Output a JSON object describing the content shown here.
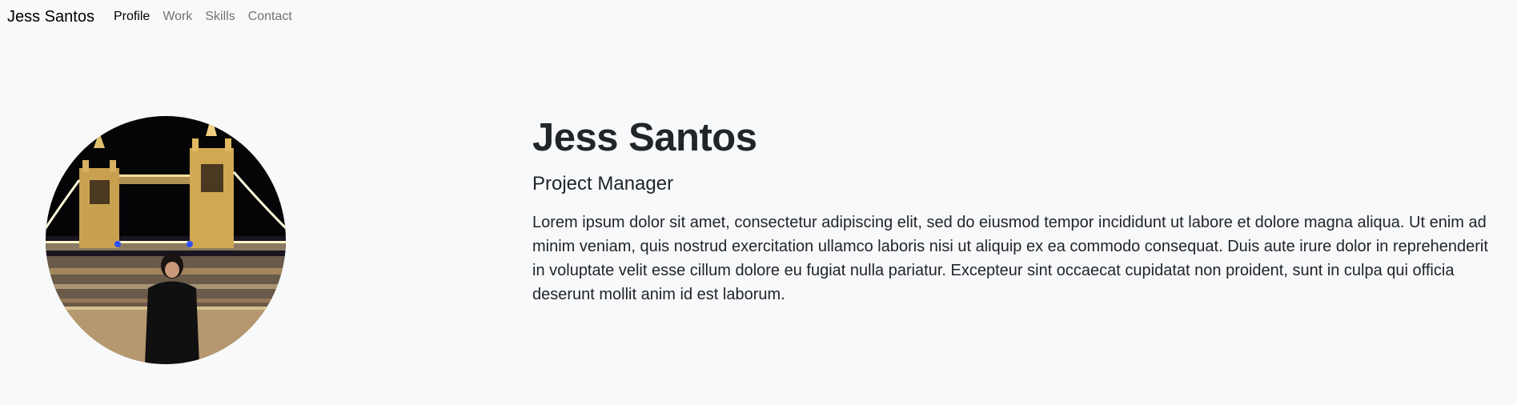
{
  "navbar": {
    "brand": "Jess Santos",
    "links": [
      {
        "label": "Profile",
        "active": true
      },
      {
        "label": "Work",
        "active": false
      },
      {
        "label": "Skills",
        "active": false
      },
      {
        "label": "Contact",
        "active": false
      }
    ]
  },
  "profile": {
    "name": "Jess Santos",
    "role": "Project Manager",
    "bio": "Lorem ipsum dolor sit amet, consectetur adipiscing elit, sed do eiusmod tempor incididunt ut labore et dolore magna aliqua. Ut enim ad minim veniam, quis nostrud exercitation ullamco laboris nisi ut aliquip ex ea commodo consequat. Duis aute irure dolor in reprehenderit in voluptate velit esse cillum dolore eu fugiat nulla pariatur. Excepteur sint occaecat cupidatat non proident, sunt in culpa qui officia deserunt mollit anim id est laborum."
  },
  "colors": {
    "background": "#f8f9fa",
    "text": "#212529",
    "nav_inactive": "rgba(0,0,0,0.55)"
  }
}
